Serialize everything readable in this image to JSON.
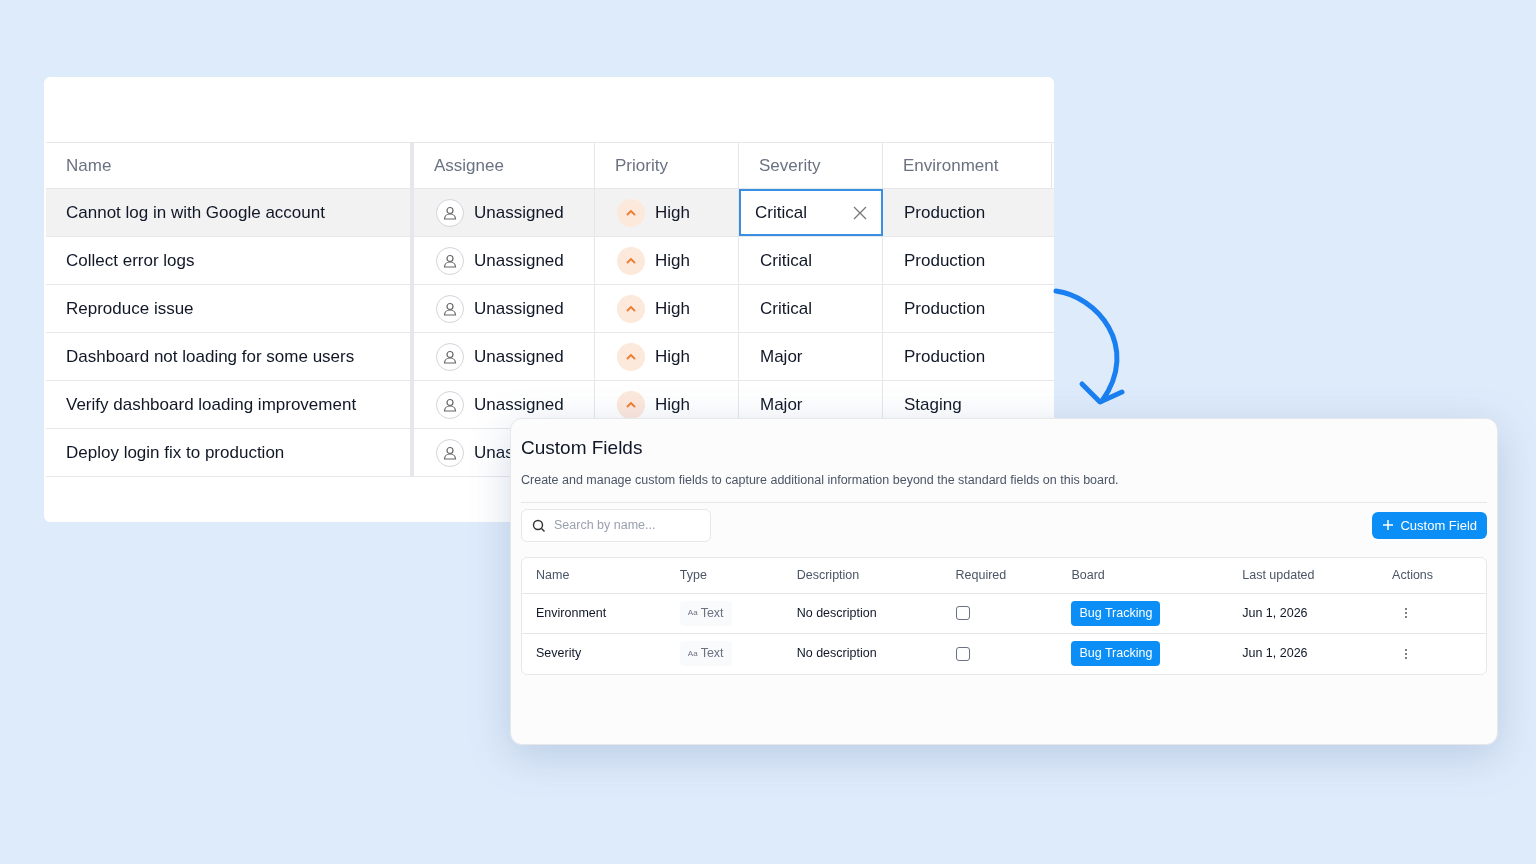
{
  "board": {
    "columns": [
      "Name",
      "Assignee",
      "Priority",
      "Severity",
      "Environment"
    ],
    "rows": [
      {
        "name": "Cannot log in with Google account",
        "assignee": "Unassigned",
        "priority": "High",
        "severity": "Critical",
        "environment": "Production",
        "selected": true,
        "editing": true
      },
      {
        "name": "Collect error logs",
        "assignee": "Unassigned",
        "priority": "High",
        "severity": "Critical",
        "environment": "Production",
        "selected": false
      },
      {
        "name": "Reproduce issue",
        "assignee": "Unassigned",
        "priority": "High",
        "severity": "Critical",
        "environment": "Production",
        "selected": false
      },
      {
        "name": "Dashboard not loading for some users",
        "assignee": "Unassigned",
        "priority": "High",
        "severity": "Major",
        "environment": "Production",
        "selected": false
      },
      {
        "name": "Verify dashboard loading improvement",
        "assignee": "Unassigned",
        "priority": "High",
        "severity": "Major",
        "environment": "Staging",
        "selected": false
      },
      {
        "name": "Deploy login fix to production",
        "assignee": "Unas",
        "selected": false
      }
    ]
  },
  "custom_fields": {
    "title": "Custom Fields",
    "description": "Create and manage custom fields to capture additional information beyond the standard fields on this board.",
    "search": {
      "placeholder": "Search by name..."
    },
    "add_button": "Custom Field",
    "columns": [
      "Name",
      "Type",
      "Description",
      "Required",
      "Board",
      "Last updated",
      "Actions"
    ],
    "rows": [
      {
        "name": "Environment",
        "type_icon": "Aa",
        "type": "Text",
        "description": "No description",
        "required": false,
        "board": "Bug Tracking",
        "updated": "Jun 1, 2026"
      },
      {
        "name": "Severity",
        "type_icon": "Aa",
        "type": "Text",
        "description": "No description",
        "required": false,
        "board": "Bug Tracking",
        "updated": "Jun 1, 2026"
      }
    ]
  }
}
